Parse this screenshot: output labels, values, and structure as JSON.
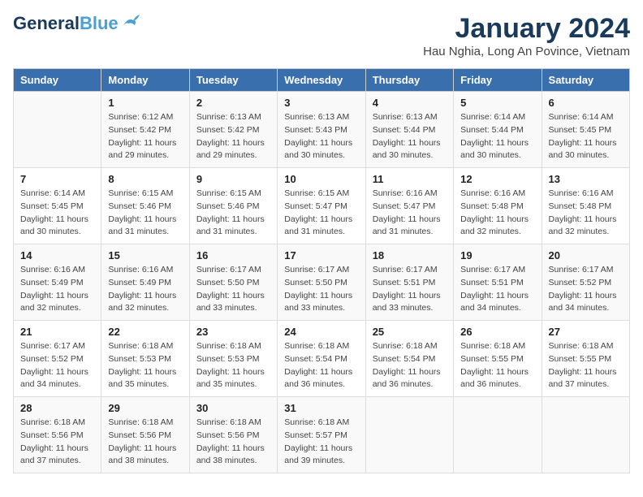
{
  "header": {
    "logo_general": "General",
    "logo_blue": "Blue",
    "title": "January 2024",
    "subtitle": "Hau Nghia, Long An Povince, Vietnam"
  },
  "days_of_week": [
    "Sunday",
    "Monday",
    "Tuesday",
    "Wednesday",
    "Thursday",
    "Friday",
    "Saturday"
  ],
  "weeks": [
    [
      {
        "day": "",
        "info": ""
      },
      {
        "day": "1",
        "info": "Sunrise: 6:12 AM\nSunset: 5:42 PM\nDaylight: 11 hours\nand 29 minutes."
      },
      {
        "day": "2",
        "info": "Sunrise: 6:13 AM\nSunset: 5:42 PM\nDaylight: 11 hours\nand 29 minutes."
      },
      {
        "day": "3",
        "info": "Sunrise: 6:13 AM\nSunset: 5:43 PM\nDaylight: 11 hours\nand 30 minutes."
      },
      {
        "day": "4",
        "info": "Sunrise: 6:13 AM\nSunset: 5:44 PM\nDaylight: 11 hours\nand 30 minutes."
      },
      {
        "day": "5",
        "info": "Sunrise: 6:14 AM\nSunset: 5:44 PM\nDaylight: 11 hours\nand 30 minutes."
      },
      {
        "day": "6",
        "info": "Sunrise: 6:14 AM\nSunset: 5:45 PM\nDaylight: 11 hours\nand 30 minutes."
      }
    ],
    [
      {
        "day": "7",
        "info": "Sunrise: 6:14 AM\nSunset: 5:45 PM\nDaylight: 11 hours\nand 30 minutes."
      },
      {
        "day": "8",
        "info": "Sunrise: 6:15 AM\nSunset: 5:46 PM\nDaylight: 11 hours\nand 31 minutes."
      },
      {
        "day": "9",
        "info": "Sunrise: 6:15 AM\nSunset: 5:46 PM\nDaylight: 11 hours\nand 31 minutes."
      },
      {
        "day": "10",
        "info": "Sunrise: 6:15 AM\nSunset: 5:47 PM\nDaylight: 11 hours\nand 31 minutes."
      },
      {
        "day": "11",
        "info": "Sunrise: 6:16 AM\nSunset: 5:47 PM\nDaylight: 11 hours\nand 31 minutes."
      },
      {
        "day": "12",
        "info": "Sunrise: 6:16 AM\nSunset: 5:48 PM\nDaylight: 11 hours\nand 32 minutes."
      },
      {
        "day": "13",
        "info": "Sunrise: 6:16 AM\nSunset: 5:48 PM\nDaylight: 11 hours\nand 32 minutes."
      }
    ],
    [
      {
        "day": "14",
        "info": "Sunrise: 6:16 AM\nSunset: 5:49 PM\nDaylight: 11 hours\nand 32 minutes."
      },
      {
        "day": "15",
        "info": "Sunrise: 6:16 AM\nSunset: 5:49 PM\nDaylight: 11 hours\nand 32 minutes."
      },
      {
        "day": "16",
        "info": "Sunrise: 6:17 AM\nSunset: 5:50 PM\nDaylight: 11 hours\nand 33 minutes."
      },
      {
        "day": "17",
        "info": "Sunrise: 6:17 AM\nSunset: 5:50 PM\nDaylight: 11 hours\nand 33 minutes."
      },
      {
        "day": "18",
        "info": "Sunrise: 6:17 AM\nSunset: 5:51 PM\nDaylight: 11 hours\nand 33 minutes."
      },
      {
        "day": "19",
        "info": "Sunrise: 6:17 AM\nSunset: 5:51 PM\nDaylight: 11 hours\nand 34 minutes."
      },
      {
        "day": "20",
        "info": "Sunrise: 6:17 AM\nSunset: 5:52 PM\nDaylight: 11 hours\nand 34 minutes."
      }
    ],
    [
      {
        "day": "21",
        "info": "Sunrise: 6:17 AM\nSunset: 5:52 PM\nDaylight: 11 hours\nand 34 minutes."
      },
      {
        "day": "22",
        "info": "Sunrise: 6:18 AM\nSunset: 5:53 PM\nDaylight: 11 hours\nand 35 minutes."
      },
      {
        "day": "23",
        "info": "Sunrise: 6:18 AM\nSunset: 5:53 PM\nDaylight: 11 hours\nand 35 minutes."
      },
      {
        "day": "24",
        "info": "Sunrise: 6:18 AM\nSunset: 5:54 PM\nDaylight: 11 hours\nand 36 minutes."
      },
      {
        "day": "25",
        "info": "Sunrise: 6:18 AM\nSunset: 5:54 PM\nDaylight: 11 hours\nand 36 minutes."
      },
      {
        "day": "26",
        "info": "Sunrise: 6:18 AM\nSunset: 5:55 PM\nDaylight: 11 hours\nand 36 minutes."
      },
      {
        "day": "27",
        "info": "Sunrise: 6:18 AM\nSunset: 5:55 PM\nDaylight: 11 hours\nand 37 minutes."
      }
    ],
    [
      {
        "day": "28",
        "info": "Sunrise: 6:18 AM\nSunset: 5:56 PM\nDaylight: 11 hours\nand 37 minutes."
      },
      {
        "day": "29",
        "info": "Sunrise: 6:18 AM\nSunset: 5:56 PM\nDaylight: 11 hours\nand 38 minutes."
      },
      {
        "day": "30",
        "info": "Sunrise: 6:18 AM\nSunset: 5:56 PM\nDaylight: 11 hours\nand 38 minutes."
      },
      {
        "day": "31",
        "info": "Sunrise: 6:18 AM\nSunset: 5:57 PM\nDaylight: 11 hours\nand 39 minutes."
      },
      {
        "day": "",
        "info": ""
      },
      {
        "day": "",
        "info": ""
      },
      {
        "day": "",
        "info": ""
      }
    ]
  ]
}
